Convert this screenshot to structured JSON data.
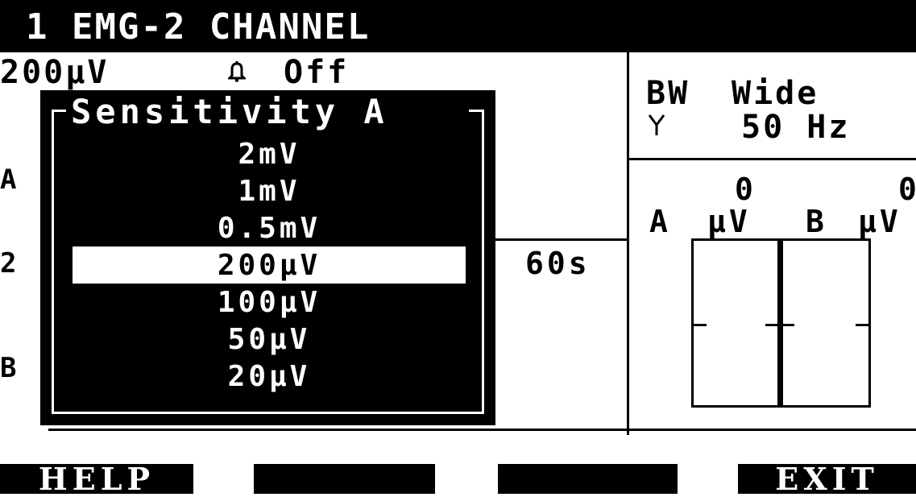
{
  "header": {
    "title": "1 EMG-2 CHANNEL"
  },
  "status": {
    "sensitivity": "200µV",
    "alarm_icon": "bell-icon",
    "alarm_state": "Off"
  },
  "channels": {
    "a_label": "A",
    "two_label": "2",
    "b_label": "B"
  },
  "time": {
    "sweep": "60s"
  },
  "filter": {
    "bw_label": "BW",
    "bw_value": "Wide",
    "notch_icon": "notch-filter-icon",
    "notch_value": "50 Hz"
  },
  "meter": {
    "a_label": "A",
    "a_value": "0",
    "a_unit": "µV",
    "b_label": "B",
    "b_value": "0",
    "b_unit": "µV"
  },
  "dialog": {
    "title": "Sensitivity A",
    "options": [
      "2mV",
      "1mV",
      "0.5mV",
      "200µV",
      "100µV",
      "50µV",
      "20µV"
    ],
    "selected_index": 3
  },
  "softkeys": [
    {
      "label": "HELP"
    },
    {
      "label": ""
    },
    {
      "label": ""
    },
    {
      "label": "EXIT"
    }
  ],
  "colors": {
    "foreground": "#000000",
    "background": "#ffffff"
  }
}
